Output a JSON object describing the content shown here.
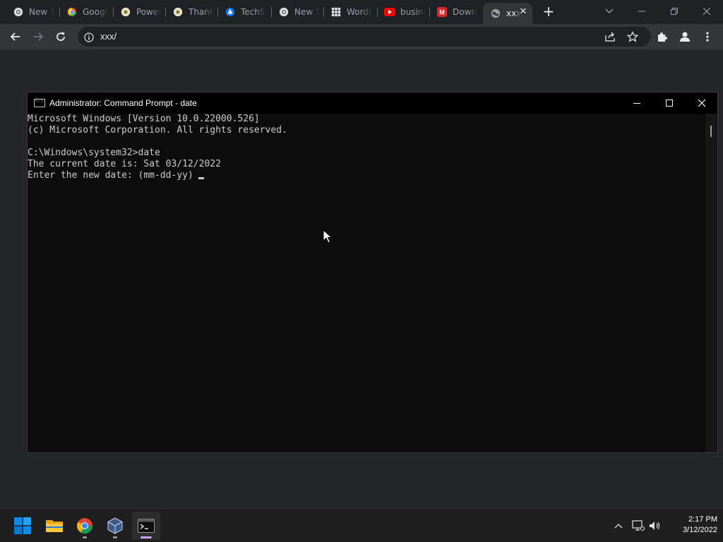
{
  "browser": {
    "tabs": [
      {
        "title": "New Tab",
        "favicon": "chrome-icon"
      },
      {
        "title": "Google",
        "favicon": "chrome-icon"
      },
      {
        "title": "PowerShell",
        "favicon": "generic-site-icon"
      },
      {
        "title": "Thank",
        "favicon": "generic-site-icon"
      },
      {
        "title": "TechSpot",
        "favicon": "techspot-icon"
      },
      {
        "title": "New Tab",
        "favicon": "chrome-icon"
      },
      {
        "title": "WordPress",
        "favicon": "grid-icon"
      },
      {
        "title": "business",
        "favicon": "youtube-icon"
      },
      {
        "title": "Download",
        "favicon": "mega-icon"
      },
      {
        "title": "xxx",
        "favicon": "globe-icon",
        "active": true
      }
    ],
    "address": "xxx/"
  },
  "cmd": {
    "title": "Administrator: Command Prompt - date",
    "lines": [
      "Microsoft Windows [Version 10.0.22000.526]",
      "(c) Microsoft Corporation. All rights reserved.",
      "",
      "C:\\Windows\\system32>date",
      "The current date is: Sat 03/12/2022",
      "Enter the new date: (mm-dd-yy)"
    ]
  },
  "taskbar": {
    "apps": [
      "start-icon",
      "file-explorer-icon",
      "chrome-icon",
      "virtualbox-icon",
      "terminal-icon"
    ],
    "time": "2:17 PM",
    "date": "3/12/2022"
  },
  "colors": {
    "chrome_bg": "#202124",
    "toolbar_bg": "#35363a",
    "cmd_bg": "#0c0c0c",
    "cmd_text": "#cccccc",
    "taskbar_bg": "#1f1f1f",
    "windows_blue": "#0078d4"
  }
}
